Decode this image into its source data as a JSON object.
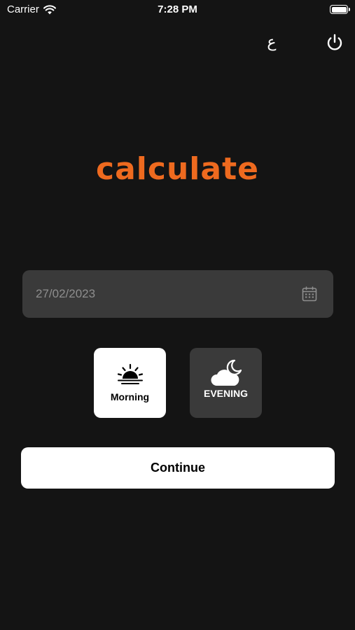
{
  "status_bar": {
    "carrier": "Carrier",
    "time": "7:28 PM",
    "icons": [
      "wifi-icon",
      "battery-icon"
    ]
  },
  "header": {
    "language_toggle": "ع",
    "power_icon": "power-icon"
  },
  "logo": {
    "text": "calculate",
    "color": "#ee6a1f"
  },
  "date_field": {
    "value": "27/02/2023",
    "icon": "calendar-icon"
  },
  "time_options": {
    "morning": {
      "label": "Morning",
      "icon": "sunrise-icon",
      "selected": true
    },
    "evening": {
      "label": "EVENING",
      "icon": "cloud-moon-icon",
      "selected": false
    }
  },
  "continue_button": {
    "label": "Continue"
  },
  "colors": {
    "background": "#141414",
    "accent": "#ee6a1f",
    "field_background": "#3a3a3a",
    "selected_background": "#ffffff"
  }
}
